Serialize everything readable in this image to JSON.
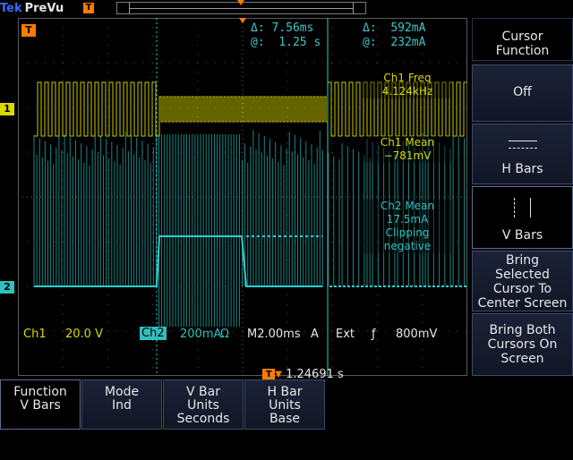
{
  "brand": {
    "maker": "Tek",
    "mode": "PreVu",
    "trigger_flag": "T"
  },
  "cursors": {
    "delta_t": "7.56ms",
    "at_t": "1.25 s",
    "delta_i": "592mA",
    "at_i": "232mA",
    "delta_symbol": "Δ:",
    "at_symbol": "@:"
  },
  "measurements": {
    "ch1_freq_label": "Ch1 Freq",
    "ch1_freq_value": "4.124kHz",
    "ch1_mean_label": "Ch1 Mean",
    "ch1_mean_value": "−781mV",
    "ch2_mean_label": "Ch2 Mean",
    "ch2_mean_value": "17.5mA",
    "ch2_note_1": "Clipping",
    "ch2_note_2": "negative"
  },
  "status": {
    "ch1": "Ch1",
    "ch1_scale": "20.0 V",
    "ch2": "Ch2",
    "ch2_scale": "200mA",
    "ch2_suffix": "Ω",
    "timebase": "M2.00ms",
    "trig_source": "A",
    "trig_mode": "Ext",
    "trig_slope": "ƒ",
    "trig_level": "800mV",
    "trig_position": "1.24691 s",
    "trig_box": "T"
  },
  "channels": {
    "ch1_marker": "1",
    "ch2_marker": "2",
    "trig_marker": "T"
  },
  "side_menu": {
    "title_1": "Cursor",
    "title_2": "Function",
    "off": "Off",
    "hbars": "H Bars",
    "vbars": "V Bars",
    "bring_1": "Bring",
    "bring_2": "Selected",
    "bring_3": "Cursor To",
    "bring_4": "Center Screen",
    "both_1": "Bring Both",
    "both_2": "Cursors On",
    "both_3": "Screen"
  },
  "bottom_menu": {
    "function_1": "Function",
    "function_2": "V Bars",
    "mode_1": "Mode",
    "mode_2": "Ind",
    "vunits_1": "V Bar",
    "vunits_2": "Units",
    "vunits_3": "Seconds",
    "hunits_1": "H Bar",
    "hunits_2": "Units",
    "hunits_3": "Base"
  },
  "colors": {
    "ch1": "#d9d900",
    "ch2": "#30c0c0",
    "trigger": "#ff7a00",
    "brand": "#3b66ff"
  }
}
